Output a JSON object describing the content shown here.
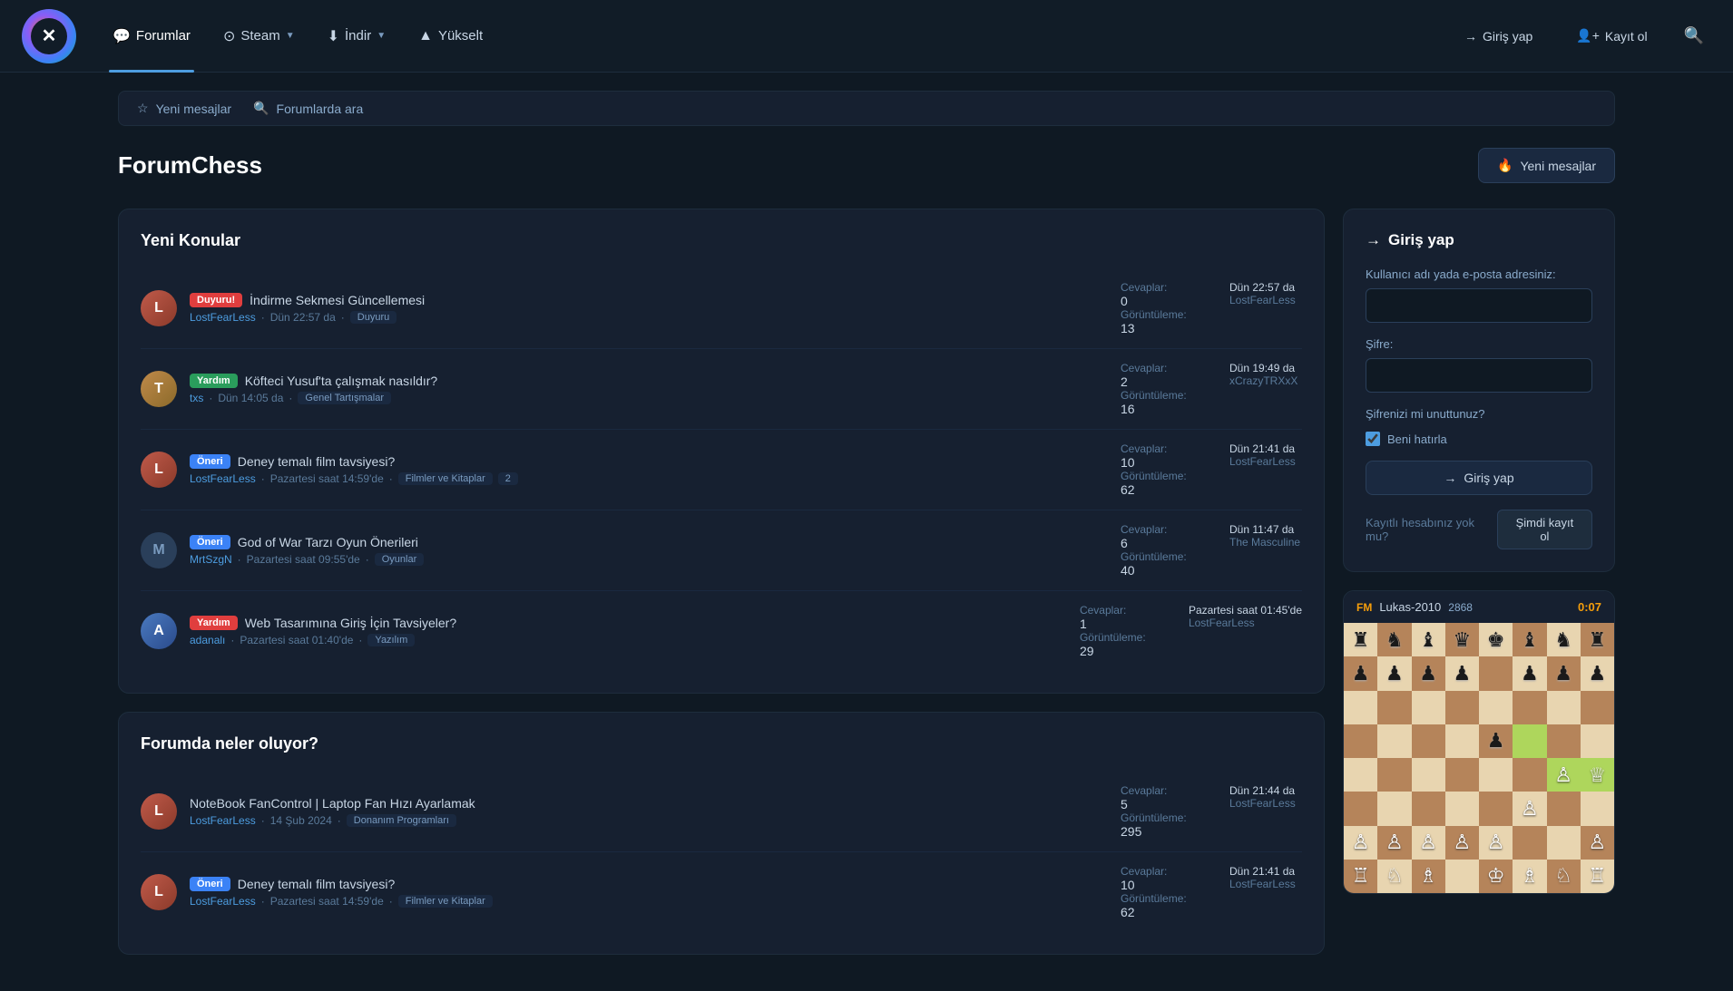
{
  "navbar": {
    "logo_text": "✕",
    "links": [
      {
        "id": "forumlar",
        "label": "Forumlar",
        "icon": "💬",
        "active": true
      },
      {
        "id": "steam",
        "label": "Steam",
        "icon": "⊙",
        "arrow": true
      },
      {
        "id": "indir",
        "label": "İndir",
        "icon": "⬇",
        "arrow": true
      },
      {
        "id": "yukselt",
        "label": "Yükselt",
        "icon": "▲",
        "arrow": false
      }
    ],
    "login_label": "Giriş yap",
    "register_label": "Kayıt ol",
    "login_icon": "→",
    "register_icon": "👤"
  },
  "search_bar": {
    "new_messages_label": "Yeni mesajlar",
    "search_placeholder": "Forumlarda ara"
  },
  "page_header": {
    "title": "ForumChess",
    "new_message_btn": "Yeni mesajlar"
  },
  "new_topics": {
    "section_title": "Yeni Konular",
    "topics": [
      {
        "avatar_type": "img",
        "avatar_color": "#c05a4a",
        "avatar_letter": "L",
        "badge": "Duyuru!",
        "badge_type": "red",
        "title": "İndirme Sekmesi Güncellemesi",
        "author": "LostFearLess",
        "date": "Dün 22:57 da",
        "category": "Duyuru",
        "replies_label": "Cevaplar:",
        "views_label": "Görüntüleme:",
        "replies": "0",
        "views": "13",
        "last_date": "Dün 22:57 da",
        "last_user": "LostFearLess"
      },
      {
        "avatar_type": "img",
        "avatar_color": "#c08a4a",
        "avatar_letter": "T",
        "badge": "Yardım",
        "badge_type": "green",
        "title": "Köfteci Yusuf'ta çalışmak nasıldır?",
        "author": "txs",
        "date": "Dün 14:05 da",
        "category": "Genel Tartışmalar",
        "replies_label": "Cevaplar:",
        "views_label": "Görüntüleme:",
        "replies": "2",
        "views": "16",
        "last_date": "Dün 19:49 da",
        "last_user": "xCrazyTRXxX"
      },
      {
        "avatar_type": "img",
        "avatar_color": "#c05a4a",
        "avatar_letter": "L",
        "badge": "Öneri",
        "badge_type": "blue",
        "title": "Deney temalı film tavsiyesi?",
        "author": "LostFearLess",
        "date": "Pazartesi saat 14:59'de",
        "category": "Filmler ve Kitaplar",
        "badge_count": "2",
        "replies_label": "Cevaplar:",
        "views_label": "Görüntüleme:",
        "replies": "10",
        "views": "62",
        "last_date": "Dün 21:41 da",
        "last_user": "LostFearLess"
      },
      {
        "avatar_type": "letter",
        "avatar_color": "#2a3f5a",
        "avatar_letter": "M",
        "badge": "Öneri",
        "badge_type": "blue",
        "title": "God of War Tarzı Oyun Önerileri",
        "author": "MrtSzgN",
        "date": "Pazartesi saat 09:55'de",
        "category": "Oyunlar",
        "replies_label": "Cevaplar:",
        "views_label": "Görüntüleme:",
        "replies": "6",
        "views": "40",
        "last_date": "Dün 11:47 da",
        "last_user": "The Masculine"
      },
      {
        "avatar_type": "img",
        "avatar_color": "#4a8ac0",
        "avatar_letter": "A",
        "badge": "Yardım",
        "badge_type": "red",
        "title": "Web Tasarımına Giriş İçin Tavsiyeler?",
        "author": "adanalı",
        "date": "Pazartesi saat 01:40'de",
        "category": "Yazılım",
        "replies_label": "Cevaplar:",
        "views_label": "Görüntüleme:",
        "replies": "1",
        "views": "29",
        "last_date": "Pazartesi saat 01:45'de",
        "last_user": "LostFearLess"
      }
    ]
  },
  "happening": {
    "section_title": "Forumda neler oluyor?",
    "topics": [
      {
        "avatar_type": "img",
        "avatar_color": "#c05a4a",
        "avatar_letter": "L",
        "badge": null,
        "title": "NoteBook FanControl | Laptop Fan Hızı Ayarlamak",
        "author": "LostFearLess",
        "date": "14 Şub 2024",
        "category": "Donanım Programları",
        "replies_label": "Cevaplar:",
        "views_label": "Görüntüleme:",
        "replies": "5",
        "views": "295",
        "last_date": "Dün 21:44 da",
        "last_user": "LostFearLess"
      },
      {
        "avatar_type": "img",
        "avatar_color": "#c05a4a",
        "avatar_letter": "L",
        "badge": "Öneri",
        "badge_type": "blue",
        "title": "Deney temalı film tavsiyesi?",
        "author": "LostFearLess",
        "date": "Pazartesi saat 14:59'de",
        "category": "Filmler ve Kitaplar",
        "replies_label": "Cevaplar:",
        "views_label": "Görüntüleme:",
        "replies": "10",
        "views": "62",
        "last_date": "Dün 21:41 da",
        "last_user": "LostFearLess"
      }
    ]
  },
  "sidebar": {
    "login_title": "Giriş yap",
    "username_label": "Kullanıcı adı yada e-posta adresiniz:",
    "password_label": "Şifre:",
    "forgot_password": "Şifrenizi mi unuttunuz?",
    "remember_label": "Beni hatırla",
    "login_btn": "Giriş yap",
    "no_account": "Kayıtlı hesabınız yok mu?",
    "register_now": "Şimdi kayıt ol"
  },
  "chess": {
    "player_rank": "FM",
    "player_name": "Lukas-2010",
    "player_rating": "2868",
    "time": "0:07",
    "board": [
      [
        "br",
        "bn",
        "bb",
        "bq",
        "bk",
        "bb",
        "bn",
        "br"
      ],
      [
        "bp",
        "bp",
        "bp",
        "bp",
        "",
        "bp",
        "bp",
        "bp"
      ],
      [
        "",
        "",
        "",
        "",
        "",
        "",
        "",
        ""
      ],
      [
        "",
        "",
        "",
        "",
        "bp",
        "",
        "",
        ""
      ],
      [
        "",
        "",
        "",
        "",
        "",
        "",
        "wp",
        "wq"
      ],
      [
        "",
        "",
        "",
        "",
        "",
        "wp",
        "",
        ""
      ],
      [
        "wp",
        "wp",
        "wp",
        "wp",
        "wp",
        "",
        "",
        "wp"
      ],
      [
        "wr",
        "wn",
        "wb",
        "",
        "wk",
        "wb",
        "wn",
        "wr"
      ]
    ]
  }
}
